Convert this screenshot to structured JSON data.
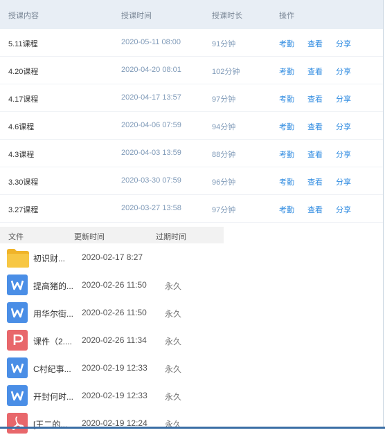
{
  "lessons": {
    "headers": [
      "授课内容",
      "授课时间",
      "授课时长",
      "操作"
    ],
    "rows": [
      {
        "name": "5.11课程",
        "time": "2020-05-11 08:00",
        "duration": "91分钟"
      },
      {
        "name": "4.20课程",
        "time": "2020-04-20 08:01",
        "duration": "102分钟"
      },
      {
        "name": "4.17课程",
        "time": "2020-04-17 13:57",
        "duration": "97分钟"
      },
      {
        "name": "4.6课程",
        "time": "2020-04-06 07:59",
        "duration": "94分钟"
      },
      {
        "name": "4.3课程",
        "time": "2020-04-03 13:59",
        "duration": "88分钟"
      },
      {
        "name": "3.30课程",
        "time": "2020-03-30 07:59",
        "duration": "96分钟"
      },
      {
        "name": "3.27课程",
        "time": "2020-03-27 13:58",
        "duration": "97分钟"
      }
    ],
    "actions": [
      "考勤",
      "查看",
      "分享"
    ]
  },
  "files": {
    "headers": [
      "文件",
      "更新时间",
      "过期时间"
    ],
    "rows": [
      {
        "type": "folder",
        "name": "初识财...",
        "updated": "2020-02-17 8:27",
        "expires": ""
      },
      {
        "type": "word",
        "name": "提高猪的...",
        "updated": "2020-02-26 11:50",
        "expires": "永久"
      },
      {
        "type": "word",
        "name": "用华尔街...",
        "updated": "2020-02-26 11:50",
        "expires": "永久"
      },
      {
        "type": "ppt",
        "name": "课件（2....",
        "updated": "2020-02-26 11:34",
        "expires": "永久"
      },
      {
        "type": "word",
        "name": "C村纪事...",
        "updated": "2020-02-19 12:33",
        "expires": "永久"
      },
      {
        "type": "word",
        "name": "开封何时...",
        "updated": "2020-02-19 12:33",
        "expires": "永久"
      },
      {
        "type": "pdf",
        "name": "[王二的...",
        "updated": "2020-02-19 12:24",
        "expires": "永久"
      }
    ]
  },
  "colors": {
    "word": "#4a8ee6",
    "ppt": "#e8676b",
    "pdf": "#e8676b",
    "folder": "#f7c744",
    "action": "#2d8ae0"
  }
}
